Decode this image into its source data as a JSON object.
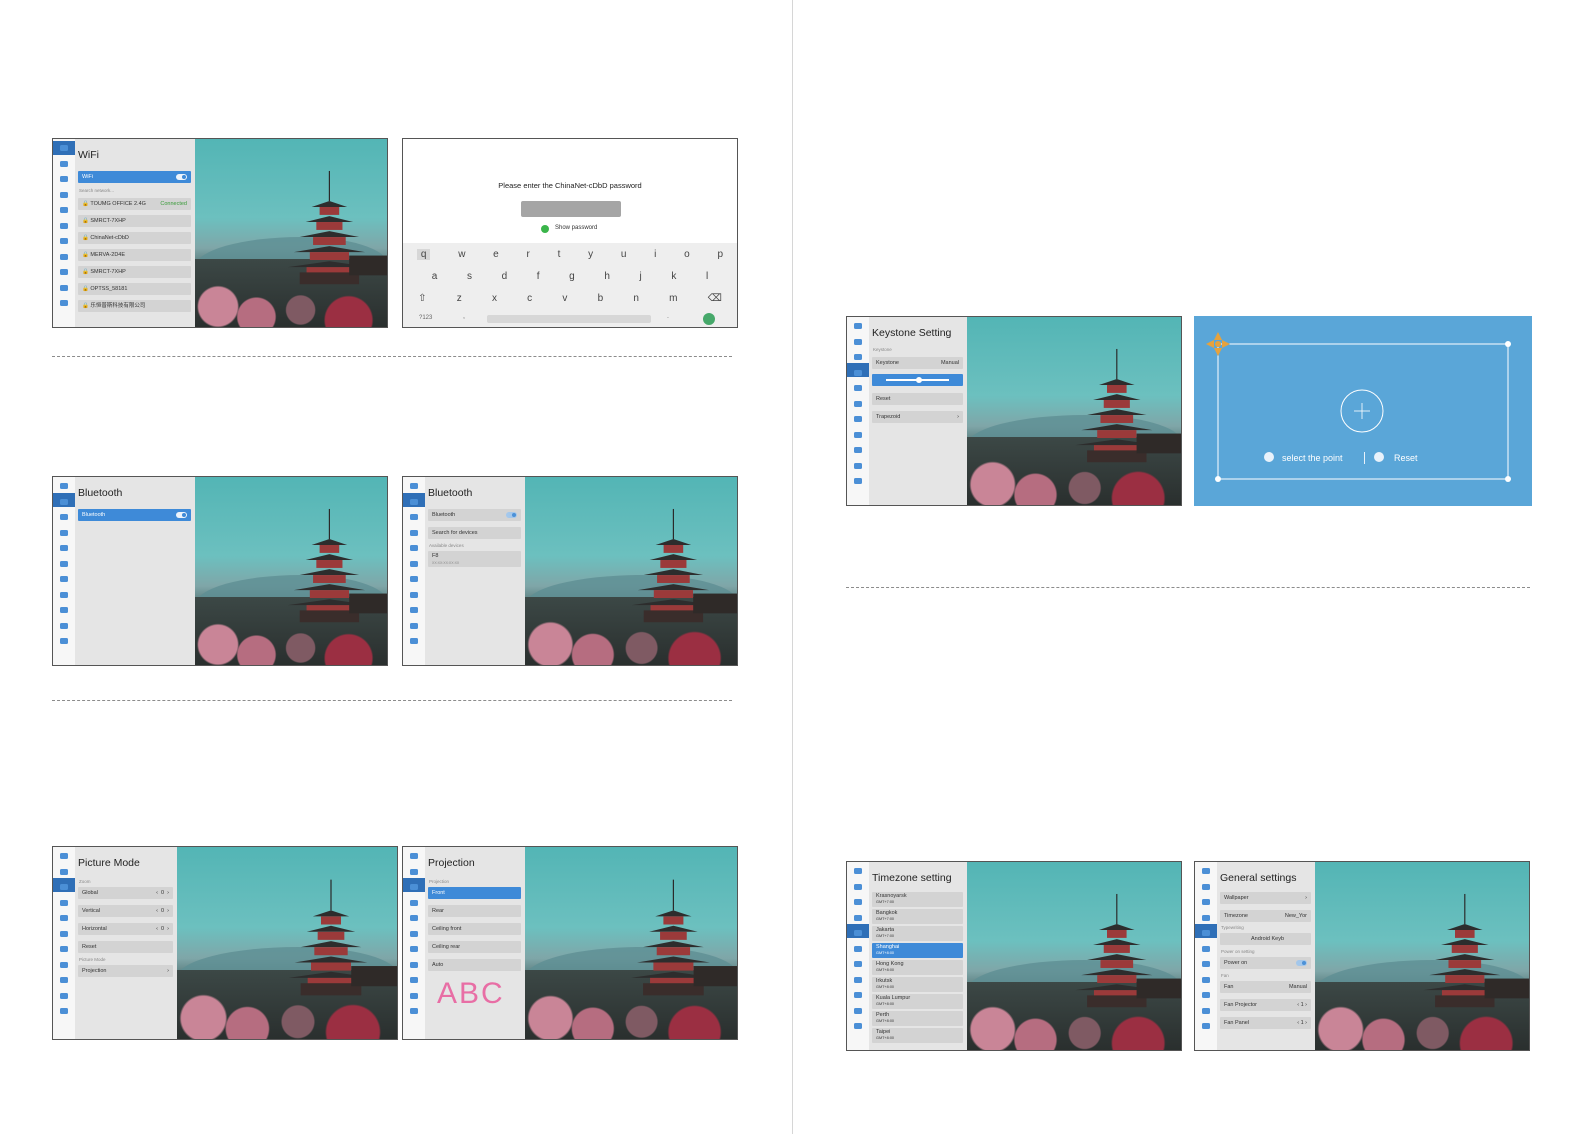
{
  "wifi": {
    "title": "WiFi",
    "toggle_label": "WiFi",
    "search_hint": "Search network...",
    "networks": [
      {
        "name": "TOUMG OFFICE 2.4G",
        "status": "Connected"
      },
      {
        "name": "SMRCT-7XHP",
        "status": ""
      },
      {
        "name": "ChinaNet-cDbD",
        "status": ""
      },
      {
        "name": "MERVA-2D4E",
        "status": ""
      },
      {
        "name": "SMRCT-7XHP",
        "status": ""
      },
      {
        "name": "OPTSS_58181",
        "status": ""
      },
      {
        "name": "乐恒普斯科技有限公司",
        "status": ""
      }
    ]
  },
  "password_dialog": {
    "prompt": "Please enter the ChinaNet-cDbD password",
    "show_password": "Show password",
    "keys_row1": [
      "q",
      "w",
      "e",
      "r",
      "t",
      "y",
      "u",
      "i",
      "o",
      "p"
    ],
    "keys_row2": [
      "a",
      "s",
      "d",
      "f",
      "g",
      "h",
      "j",
      "k",
      "l"
    ],
    "keys_row3": [
      "z",
      "x",
      "c",
      "v",
      "b",
      "n",
      "m"
    ],
    "symbols_key": "?123",
    "comma_key": ",",
    "period_key": "."
  },
  "bluetooth1": {
    "title": "Bluetooth",
    "toggle_label": "Bluetooth"
  },
  "bluetooth2": {
    "title": "Bluetooth",
    "toggle_label": "Bluetooth",
    "search_label": "Search for devices",
    "available_label": "Available devices",
    "device_name": "F8",
    "device_sub": "XX:XX:XX:XX:XX"
  },
  "picture_mode": {
    "title": "Picture Mode",
    "zoom_label": "Zoom",
    "rows": [
      {
        "label": "Global",
        "value": "0"
      },
      {
        "label": "Vertical",
        "value": "0"
      },
      {
        "label": "Horizontal",
        "value": "0"
      }
    ],
    "reset_label": "Reset",
    "section_label": "Picture Mode",
    "projection_label": "Projection"
  },
  "projection": {
    "title": "Projection",
    "section_label": "Projection",
    "options": [
      "Front",
      "Rear",
      "Ceiling front",
      "Ceiling rear",
      "Auto"
    ],
    "logo_text": "ABC"
  },
  "keystone": {
    "title": "Keystone Setting",
    "section_label": "Keystone",
    "keystone_label": "Keystone",
    "keystone_value": "Manual",
    "reset_label": "Reset",
    "trapezoid_label": "Trapezoid"
  },
  "keystone_overlay": {
    "select_label": "select the point",
    "reset_label": "Reset"
  },
  "timezone": {
    "title": "Timezone setting",
    "zones": [
      {
        "city": "Krasnoyarsk",
        "gmt": "GMT+7:00"
      },
      {
        "city": "Bangkok",
        "gmt": "GMT+7:00"
      },
      {
        "city": "Jakarta",
        "gmt": "GMT+7:00"
      },
      {
        "city": "Shanghai",
        "gmt": "GMT+8:00"
      },
      {
        "city": "Hong Kong",
        "gmt": "GMT+8:00"
      },
      {
        "city": "Irkutsk",
        "gmt": "GMT+8:00"
      },
      {
        "city": "Kuala Lumpur",
        "gmt": "GMT+8:00"
      },
      {
        "city": "Perth",
        "gmt": "GMT+8:00"
      },
      {
        "city": "Taipei",
        "gmt": "GMT+8:00"
      }
    ]
  },
  "general": {
    "title": "General settings",
    "wallpaper_label": "Wallpaper",
    "timezone_label": "Timezone",
    "timezone_value": "New_Yor",
    "typewriting_label": "Typewriting",
    "keyboard_value": "Android Keyb",
    "power_section": "Power on setting",
    "power_label": "Power on",
    "fan_section": "Fan",
    "fan_label": "Fan",
    "fan_value": "Manual",
    "fan_projector_label": "Fan Projector",
    "fan_projector_value": "1",
    "fan_panel_label": "Fan Panel",
    "fan_panel_value": "1"
  },
  "colors": {
    "accent": "#3e8ad8",
    "rail_selected": "#2f6fb7",
    "keystone_bg": "#5aa6d8",
    "marker": "#e6a23c"
  }
}
